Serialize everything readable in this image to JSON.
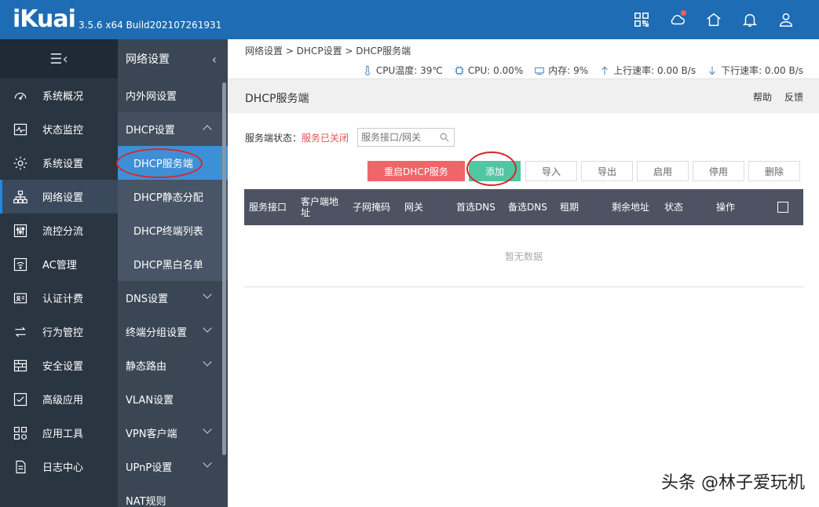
{
  "header": {
    "logo": "iKuai",
    "version": "3.5.6 x64 Build202107261931",
    "icons": [
      "qrcode-icon",
      "cloud-icon",
      "home-icon",
      "bell-icon",
      "user-icon"
    ],
    "accent": "#1E6CB3"
  },
  "nav": {
    "items": [
      {
        "label": "系统概况",
        "icon": "dashboard-icon"
      },
      {
        "label": "状态监控",
        "icon": "monitor-icon"
      },
      {
        "label": "系统设置",
        "icon": "gear-icon"
      },
      {
        "label": "网络设置",
        "icon": "network-icon",
        "active": true
      },
      {
        "label": "流控分流",
        "icon": "sliders-icon"
      },
      {
        "label": "AC管理",
        "icon": "wifi-icon"
      },
      {
        "label": "认证计费",
        "icon": "id-card-icon"
      },
      {
        "label": "行为管控",
        "icon": "arrows-icon"
      },
      {
        "label": "安全设置",
        "icon": "firewall-icon"
      },
      {
        "label": "高级应用",
        "icon": "check-icon"
      },
      {
        "label": "应用工具",
        "icon": "apps-icon"
      },
      {
        "label": "日志中心",
        "icon": "document-icon"
      }
    ]
  },
  "subnav": {
    "title": "网络设置",
    "items": [
      {
        "label": "内外网设置"
      },
      {
        "label": "DHCP设置",
        "expanded": true
      },
      {
        "label": "DHCP服务端",
        "child": true,
        "active": true
      },
      {
        "label": "DHCP静态分配",
        "child": true
      },
      {
        "label": "DHCP终端列表",
        "child": true
      },
      {
        "label": "DHCP黑白名单",
        "child": true
      },
      {
        "label": "DNS设置",
        "collapsed": true
      },
      {
        "label": "终端分组设置",
        "collapsed": true
      },
      {
        "label": "静态路由",
        "collapsed": true
      },
      {
        "label": "VLAN设置"
      },
      {
        "label": "VPN客户端",
        "collapsed": true
      },
      {
        "label": "UPnP设置",
        "collapsed": true
      },
      {
        "label": "NAT规则"
      }
    ]
  },
  "main": {
    "breadcrumb": "网络设置 > DHCP设置 > DHCP服务端",
    "status": {
      "cpu_temp": "CPU温度: 39℃",
      "cpu": "CPU: 0.00%",
      "memory": "内存: 9%",
      "upload": "上行速率: 0.00 B/s",
      "download": "下行速率: 0.00 B/s"
    },
    "panel_title": "DHCP服务端",
    "help": "帮助",
    "feedback": "反馈",
    "server_status_label": "服务端状态：",
    "server_status_value": "服务已关闭",
    "search_placeholder": "服务接口/网关",
    "buttons": {
      "restart": "重启DHCP服务",
      "add": "添加",
      "import": "导入",
      "export": "导出",
      "enable": "启用",
      "disable": "停用",
      "delete": "删除"
    },
    "table": {
      "columns": [
        "服务接口",
        "客户端地址",
        "子网掩码",
        "网关",
        "首选DNS",
        "备选DNS",
        "租期",
        "剩余地址",
        "状态",
        "操作"
      ],
      "empty": "暂无数据"
    }
  },
  "watermark": "头条 @林子爱玩机"
}
